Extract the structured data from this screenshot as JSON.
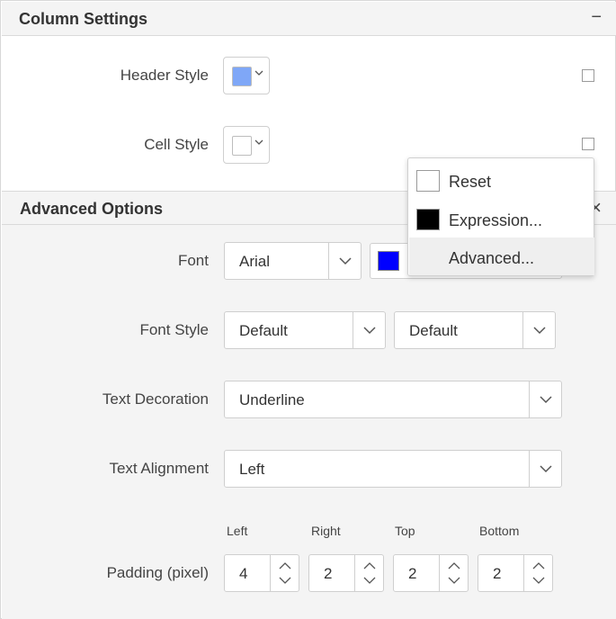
{
  "column_settings": {
    "title": "Column Settings",
    "collapse_glyph": "−",
    "header_style_label": "Header Style",
    "cell_style_label": "Cell Style",
    "header_swatch_color": "#7fa7f7",
    "cell_swatch_color": "#ffffff"
  },
  "advanced_options": {
    "title": "Advanced Options",
    "collapse_glyph": "×",
    "font_label": "Font",
    "font_value": "Arial",
    "font_color": "#0000ff",
    "font_style_label": "Font Style",
    "font_style_value_1": "Default",
    "font_style_value_2": "Default",
    "text_decoration_label": "Text Decoration",
    "text_decoration_value": "Underline",
    "text_alignment_label": "Text Alignment",
    "text_alignment_value": "Left",
    "padding_label": "Padding (pixel)",
    "padding": {
      "left_label": "Left",
      "left": "4",
      "right_label": "Right",
      "right": "2",
      "top_label": "Top",
      "top": "2",
      "bottom_label": "Bottom",
      "bottom": "2"
    }
  },
  "context_menu": {
    "items": [
      {
        "label": "Reset",
        "swatch": "#ffffff"
      },
      {
        "label": "Expression...",
        "swatch": "#000000"
      },
      {
        "label": "Advanced..."
      }
    ]
  },
  "colors": {
    "header_bg": "#f4f4f4",
    "border": "#cfcfcf",
    "menu_hover": "#efefef"
  }
}
